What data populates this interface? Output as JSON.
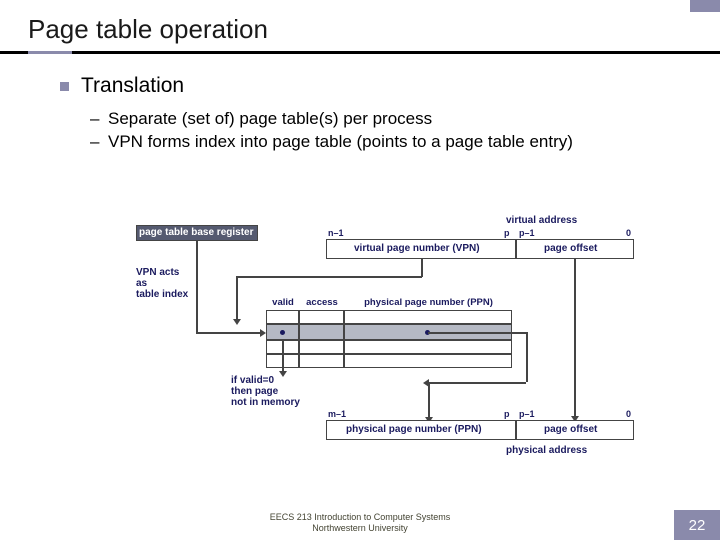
{
  "title": "Page table operation",
  "bullet": "Translation",
  "sub": [
    "Separate (set of) page table(s) per process",
    "VPN forms index into page table (points to a page table entry)"
  ],
  "diagram": {
    "ptbr": "page table base register",
    "vaddr": "virtual address",
    "va_ticks": {
      "n1": "n–1",
      "p": "p",
      "p1": "p–1",
      "z": "0"
    },
    "vpn": "virtual page number (VPN)",
    "voff": "page offset",
    "vpn_acts": "VPN acts\nas\ntable index",
    "cols": {
      "valid": "valid",
      "access": "access",
      "ppn": "physical page number (PPN)"
    },
    "invalid": "if valid=0\nthen page\nnot in memory",
    "pa_ticks": {
      "m1": "m–1",
      "p": "p",
      "p1": "p–1",
      "z": "0"
    },
    "ppn_box": "physical page number (PPN)",
    "poff": "page offset",
    "paddr": "physical address"
  },
  "footer": {
    "line1": "EECS 213 Introduction to Computer Systems",
    "line2": "Northwestern University"
  },
  "pagenum": "22"
}
